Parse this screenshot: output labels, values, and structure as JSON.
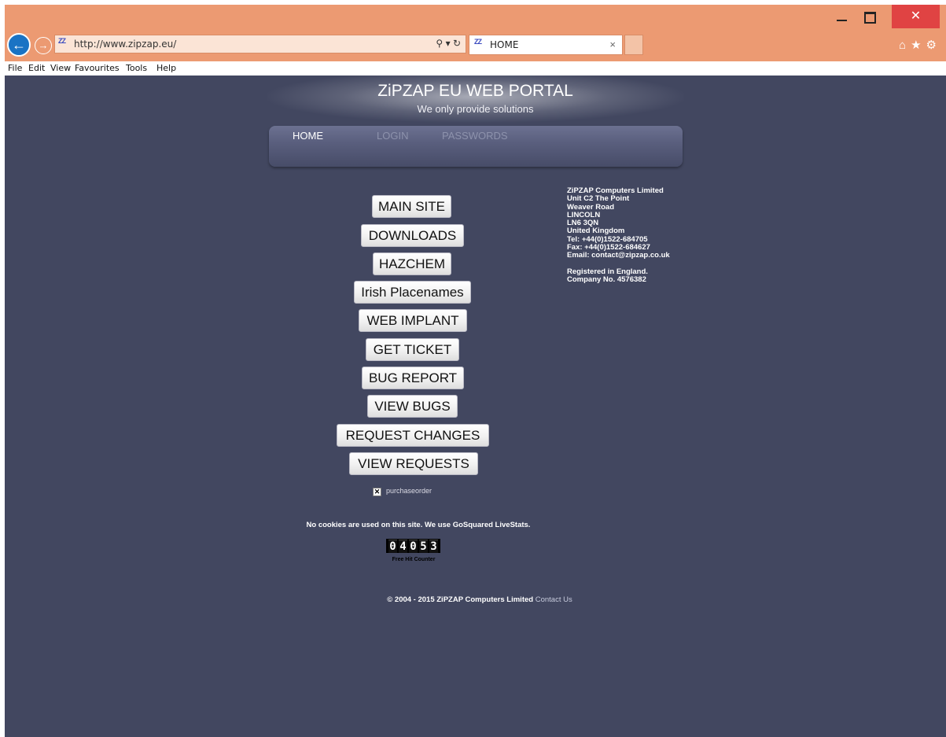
{
  "browser": {
    "address": "http://www.zipzap.eu/",
    "tab_title": "HOME",
    "favicon_text": "ZZ",
    "menu": [
      "File",
      "Edit",
      "View",
      "Favourites",
      "Tools",
      "Help"
    ],
    "icons": [
      "back-icon",
      "forward-icon",
      "search-icon",
      "refresh-icon",
      "home-icon",
      "star-icon",
      "gear-icon",
      "minimize-icon",
      "maximize-icon",
      "close-icon"
    ]
  },
  "site": {
    "title": "ZiPZAP EU WEB PORTAL",
    "tagline": "We only provide solutions"
  },
  "nav": {
    "home": "HOME",
    "login": "LOGIN",
    "passwords": "PASSWORDS"
  },
  "links": [
    {
      "label": "MAIN SITE"
    },
    {
      "label": "DOWNLOADS"
    },
    {
      "label": "HAZCHEM"
    },
    {
      "label": "Irish Placenames"
    },
    {
      "label": "WEB IMPLANT"
    },
    {
      "label": "GET TICKET"
    },
    {
      "label": "BUG REPORT"
    },
    {
      "label": "VIEW BUGS"
    },
    {
      "label": "REQUEST CHANGES"
    },
    {
      "label": "VIEW REQUESTS"
    }
  ],
  "broken_image_alt": "purchaseorder",
  "contact": [
    "ZiPZAP Computers Limited",
    "Unit C2 The Point",
    "Weaver Road",
    "LINCOLN",
    "LN6 3QN",
    "United Kingdom",
    "Tel: +44(0)1522-684705",
    "Fax: +44(0)1522-684627",
    "Email: contact@zipzap.co.uk",
    "",
    "Registered in England.",
    "Company No. 4576382"
  ],
  "cookies_text": "No cookies are used on this site. We use GoSquared LiveStats.",
  "counter": {
    "digits": [
      "0",
      "4",
      "0",
      "5",
      "3"
    ],
    "label": "Free Hit Counter"
  },
  "footer": {
    "copyright": "© 2004 - 2015 ZiPZAP Computers Limited",
    "contact_link": "Contact Us"
  }
}
